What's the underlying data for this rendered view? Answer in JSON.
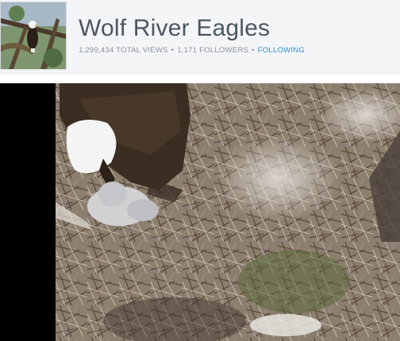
{
  "channel": {
    "title": "Wolf River Eagles",
    "stats": {
      "views": "1,299,434 TOTAL VIEWS",
      "followers": "1,171 FOLLOWERS",
      "following_label": "FOLLOWING",
      "separator": "•"
    }
  },
  "colors": {
    "title": "#4a5763",
    "stats_text": "#8a949e",
    "link": "#2b8fd6",
    "header_bg": "#f4f5f7",
    "player_bg": "#000000"
  },
  "icons": {
    "avatar": "eagle-avatar-thumbnail"
  }
}
